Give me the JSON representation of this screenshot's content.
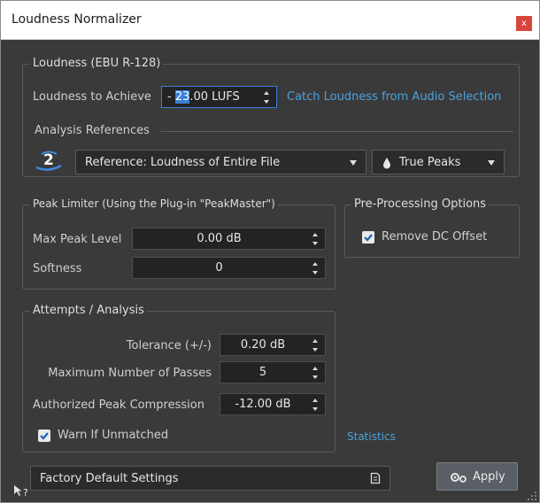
{
  "window": {
    "title": "Loudness Normalizer",
    "close_label": "x"
  },
  "loudness": {
    "group_title": "Loudness (EBU R-128)",
    "achieve_label": "Loudness to Achieve",
    "value_prefix": "- ",
    "value_selected": "23",
    "value_suffix": ".00 LUFS",
    "catch_link": "Catch Loudness from Audio Selection"
  },
  "analysis": {
    "title": "Analysis References",
    "reference_value": "Reference: Loudness of Entire File",
    "peaks_value": "True Peaks"
  },
  "peak_limiter": {
    "title": "Peak Limiter (Using the Plug-in \"PeakMaster\")",
    "max_peak_label": "Max Peak Level",
    "max_peak_value": "0.00 dB",
    "softness_label": "Softness",
    "softness_value": "0"
  },
  "preprocessing": {
    "title": "Pre-Processing Options",
    "remove_dc_label": "Remove DC Offset",
    "remove_dc_checked": true
  },
  "attempts": {
    "title": "Attempts / Analysis",
    "tolerance_label": "Tolerance (+/-)",
    "tolerance_value": "0.20 dB",
    "passes_label": "Maximum Number of Passes",
    "passes_value": "5",
    "compression_label": "Authorized Peak Compression",
    "compression_value": "-12.00 dB",
    "warn_label": "Warn If Unmatched",
    "warn_checked": true
  },
  "statistics_link": "Statistics",
  "footer": {
    "preset_value": "Factory Default Settings",
    "apply_label": "Apply",
    "help_glyph": "?"
  },
  "colors": {
    "accent": "#3a7fd8",
    "link": "#4aa3df",
    "panel": "#3a3a3a",
    "close": "#d9453b"
  }
}
